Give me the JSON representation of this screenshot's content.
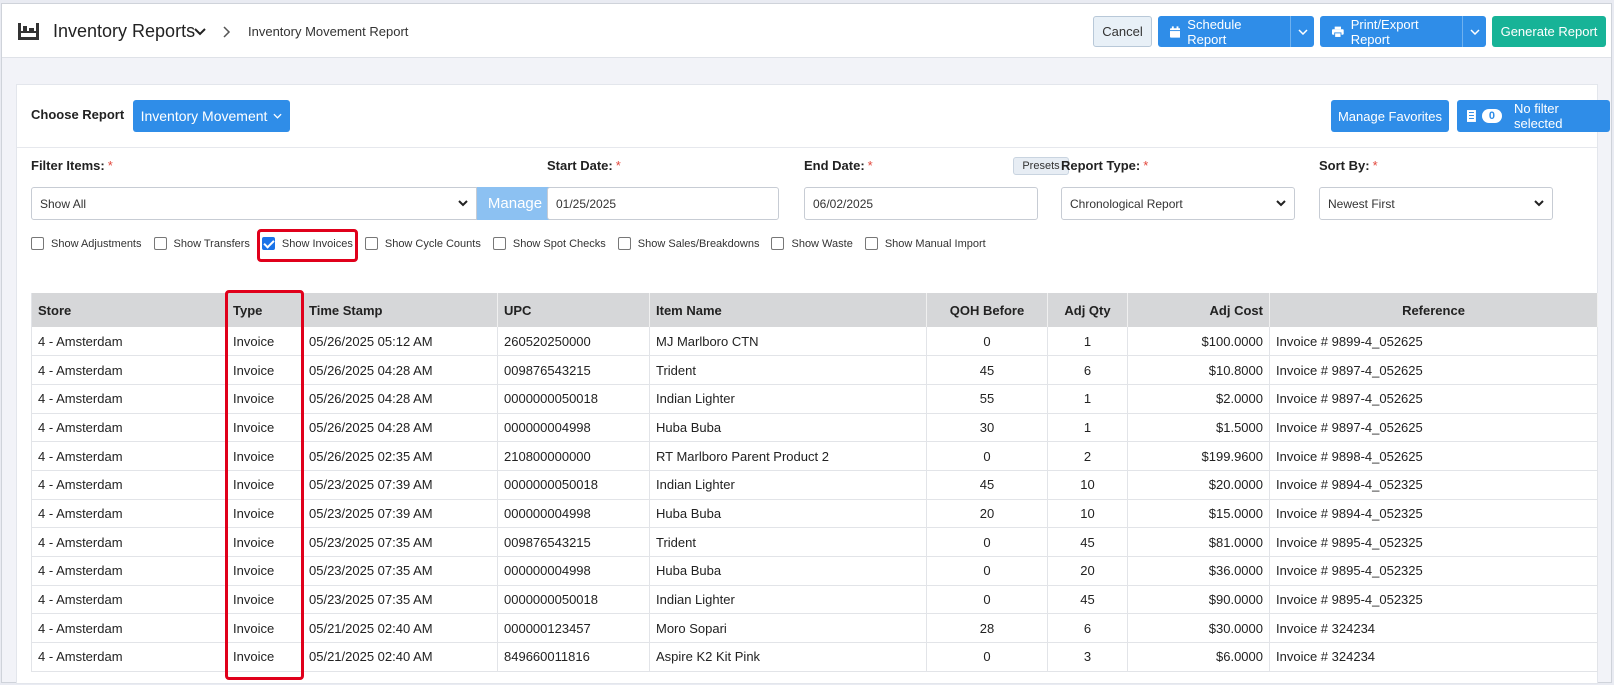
{
  "header": {
    "app_title": "Inventory Reports",
    "breadcrumb_current": "Inventory Movement Report",
    "cancel_label": "Cancel",
    "schedule_label": "Schedule Report",
    "print_label": "Print/Export Report",
    "generate_label": "Generate Report"
  },
  "report_bar": {
    "choose_label": "Choose Report",
    "report_selected": "Inventory Movement",
    "manage_favorites_label": "Manage Favorites",
    "filter_count": "0",
    "filter_label": "No filter selected"
  },
  "filters": {
    "filter_items_label": "Filter Items:",
    "filter_items_value": "Show All",
    "manage_label": "Manage",
    "start_date_label": "Start Date:",
    "start_date_value": "01/25/2025",
    "end_date_label": "End Date:",
    "end_date_value": "06/02/2025",
    "presets_label": "Presets",
    "report_type_label": "Report Type:",
    "report_type_value": "Chronological Report",
    "sort_by_label": "Sort By:",
    "sort_by_value": "Newest First",
    "required_mark": "*"
  },
  "checkboxes": [
    {
      "label": "Show Adjustments",
      "checked": false
    },
    {
      "label": "Show Transfers",
      "checked": false
    },
    {
      "label": "Show Invoices",
      "checked": true
    },
    {
      "label": "Show Cycle Counts",
      "checked": false
    },
    {
      "label": "Show Spot Checks",
      "checked": false
    },
    {
      "label": "Show Sales/Breakdowns",
      "checked": false
    },
    {
      "label": "Show Waste",
      "checked": false
    },
    {
      "label": "Show Manual Import",
      "checked": false
    }
  ],
  "table": {
    "columns": [
      "Store",
      "Type",
      "Time Stamp",
      "UPC",
      "Item Name",
      "QOH Before",
      "Adj Qty",
      "Adj Cost",
      "Reference"
    ],
    "rows": [
      [
        "4 - Amsterdam",
        "Invoice",
        "05/26/2025 05:12 AM",
        "260520250000",
        "MJ Marlboro CTN",
        "0",
        "1",
        "$100.0000",
        "Invoice # 9899-4_052625"
      ],
      [
        "4 - Amsterdam",
        "Invoice",
        "05/26/2025 04:28 AM",
        "009876543215",
        "Trident",
        "45",
        "6",
        "$10.8000",
        "Invoice # 9897-4_052625"
      ],
      [
        "4 - Amsterdam",
        "Invoice",
        "05/26/2025 04:28 AM",
        "0000000050018",
        "Indian Lighter",
        "55",
        "1",
        "$2.0000",
        "Invoice # 9897-4_052625"
      ],
      [
        "4 - Amsterdam",
        "Invoice",
        "05/26/2025 04:28 AM",
        "000000004998",
        "Huba Buba",
        "30",
        "1",
        "$1.5000",
        "Invoice # 9897-4_052625"
      ],
      [
        "4 - Amsterdam",
        "Invoice",
        "05/26/2025 02:35 AM",
        "210800000000",
        "RT Marlboro Parent Product 2",
        "0",
        "2",
        "$199.9600",
        "Invoice # 9898-4_052625"
      ],
      [
        "4 - Amsterdam",
        "Invoice",
        "05/23/2025 07:39 AM",
        "0000000050018",
        "Indian Lighter",
        "45",
        "10",
        "$20.0000",
        "Invoice # 9894-4_052325"
      ],
      [
        "4 - Amsterdam",
        "Invoice",
        "05/23/2025 07:39 AM",
        "000000004998",
        "Huba Buba",
        "20",
        "10",
        "$15.0000",
        "Invoice # 9894-4_052325"
      ],
      [
        "4 - Amsterdam",
        "Invoice",
        "05/23/2025 07:35 AM",
        "009876543215",
        "Trident",
        "0",
        "45",
        "$81.0000",
        "Invoice # 9895-4_052325"
      ],
      [
        "4 - Amsterdam",
        "Invoice",
        "05/23/2025 07:35 AM",
        "000000004998",
        "Huba Buba",
        "0",
        "20",
        "$36.0000",
        "Invoice # 9895-4_052325"
      ],
      [
        "4 - Amsterdam",
        "Invoice",
        "05/23/2025 07:35 AM",
        "0000000050018",
        "Indian Lighter",
        "0",
        "45",
        "$90.0000",
        "Invoice # 9895-4_052325"
      ],
      [
        "4 - Amsterdam",
        "Invoice",
        "05/21/2025 02:40 AM",
        "000000123457",
        "Moro Sopari",
        "28",
        "6",
        "$30.0000",
        "Invoice # 324234"
      ],
      [
        "4 - Amsterdam",
        "Invoice",
        "05/21/2025 02:40 AM",
        "849660011816",
        "Aspire K2 Kit Pink",
        "0",
        "3",
        "$6.0000",
        "Invoice # 324234"
      ]
    ]
  }
}
